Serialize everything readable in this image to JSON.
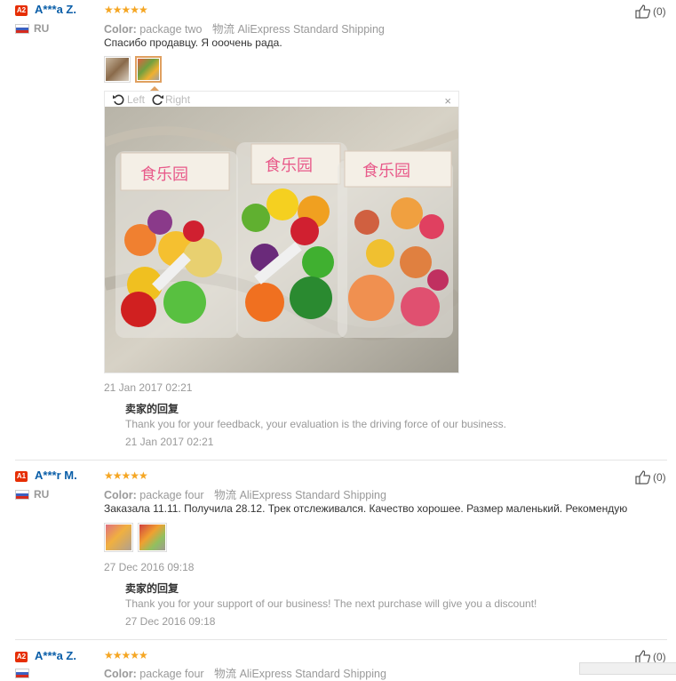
{
  "reviews": [
    {
      "level": "A2",
      "name": "A***a Z.",
      "country": "RU",
      "stars": "★★★★★",
      "color_label": "Color:",
      "color_value": "package two",
      "shipping_cn": "物流",
      "shipping": "AliExpress Standard Shipping",
      "text": "Спасибо продавцу. Я ооочень рада.",
      "date": "21 Jan 2017 02:21",
      "seller_title": "卖家的回复",
      "seller_text": "Thank you for your feedback, your evaluation is the driving force of our business.",
      "seller_date": "21 Jan 2017 02:21",
      "likes": "(0)"
    },
    {
      "level": "A1",
      "name": "A***r M.",
      "country": "RU",
      "stars": "★★★★★",
      "color_label": "Color:",
      "color_value": "package four",
      "shipping_cn": "物流",
      "shipping": "AliExpress Standard Shipping",
      "text": "Заказала 11.11. Получила 28.12. Трек отслеживался. Качество хорошее. Размер маленький. Рекомендую",
      "date": "27 Dec 2016 09:18",
      "seller_title": "卖家的回复",
      "seller_text": "Thank you for your support of our business! The next purchase will give you a discount!",
      "seller_date": "27 Dec 2016 09:18",
      "likes": "(0)"
    },
    {
      "level": "A2",
      "name": "A***a Z.",
      "country": "RU",
      "stars": "★★★★★",
      "color_label": "Color:",
      "color_value": "package four",
      "shipping_cn": "物流",
      "shipping": "AliExpress Standard Shipping",
      "likes": "(0)"
    }
  ],
  "viewer": {
    "left_label": "Left",
    "right_label": "Right",
    "close": "×"
  },
  "colors": {
    "name": "#0a5ea8",
    "stars": "#f5a623",
    "badge": "#e62e04"
  }
}
